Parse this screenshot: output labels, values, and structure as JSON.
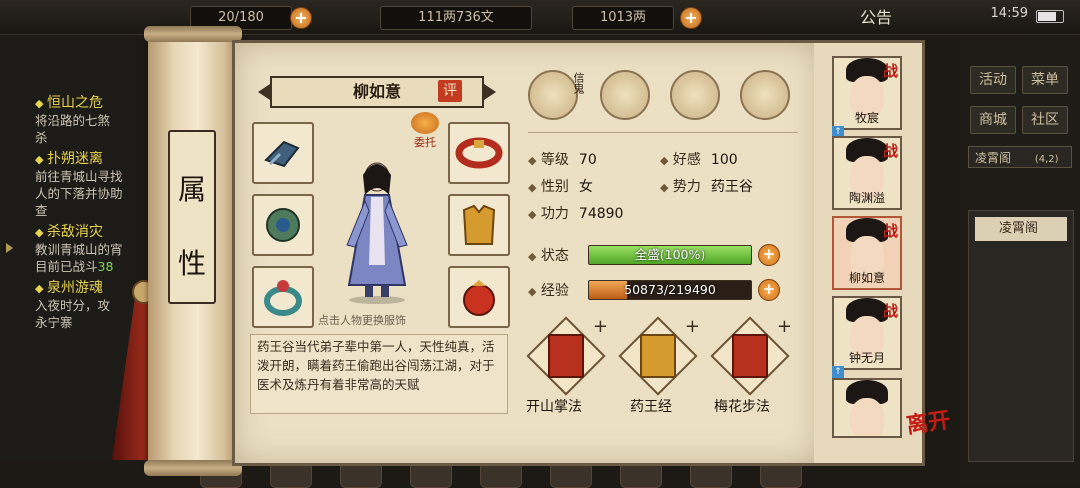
{
  "topbar": {
    "stamina": "20/180",
    "money_wen": "111两736文",
    "money_liang": "1013两",
    "announce": "公告",
    "time": "14:59"
  },
  "quests": [
    {
      "title": "恒山之危",
      "desc": "将沿路的七煞\n杀"
    },
    {
      "title": "扑朔迷离",
      "desc": "前往青城山寻找\n人的下落并协助\n查"
    },
    {
      "title": "杀敌消灾",
      "desc": "教训青城山的宵\n目前已战斗",
      "count": "38"
    },
    {
      "title": "泉州游魂",
      "desc": "入夜时分，攻\n永宁寨"
    }
  ],
  "right_menu": {
    "activity": "活动",
    "menu": "菜单",
    "shop": "商城",
    "community": "社区",
    "location": "凌霄阁",
    "coords": "(4,2)",
    "location2": "凌霄阁"
  },
  "scroll_label": [
    "属",
    "性"
  ],
  "character": {
    "name": "柳如意",
    "rate": "评",
    "trust": "委托",
    "hint": "点击人物更换服饰",
    "description": "药王谷当代弟子辈中第一人，天性纯真，活泼开朗，瞒着药王偷跑出谷闯荡江湖，对于医术及炼丹有着非常高的天赋"
  },
  "top_icons": {
    "letter": "信鬼"
  },
  "stats": {
    "level_label": "等级",
    "level": "70",
    "favor_label": "好感",
    "favor": "100",
    "gender_label": "性别",
    "gender": "女",
    "faction_label": "势力",
    "faction": "药王谷",
    "power_label": "功力",
    "power": "74890",
    "status_label": "状态",
    "status_text": "全盛(100%)",
    "status_fraction": 1.0,
    "exp_label": "经验",
    "exp_text": "50873/219490",
    "exp_fraction": 0.232
  },
  "skills": [
    {
      "name": "开山掌法",
      "color": "#b8301e"
    },
    {
      "name": "药王经",
      "color": "#d69b2e"
    },
    {
      "name": "梅花步法",
      "color": "#b8301e"
    }
  ],
  "party": [
    {
      "name": "牧宸",
      "tag": "战"
    },
    {
      "name": "陶渊溢",
      "tag": "战"
    },
    {
      "name": "柳如意",
      "tag": "战"
    },
    {
      "name": "钟无月",
      "tag": "战"
    },
    {
      "name": "",
      "tag": ""
    }
  ],
  "leave": "离开",
  "colors": {
    "status_fill": "#6cc43a",
    "exp_fill": "#d9782a",
    "paper": "#ebe0c4"
  }
}
